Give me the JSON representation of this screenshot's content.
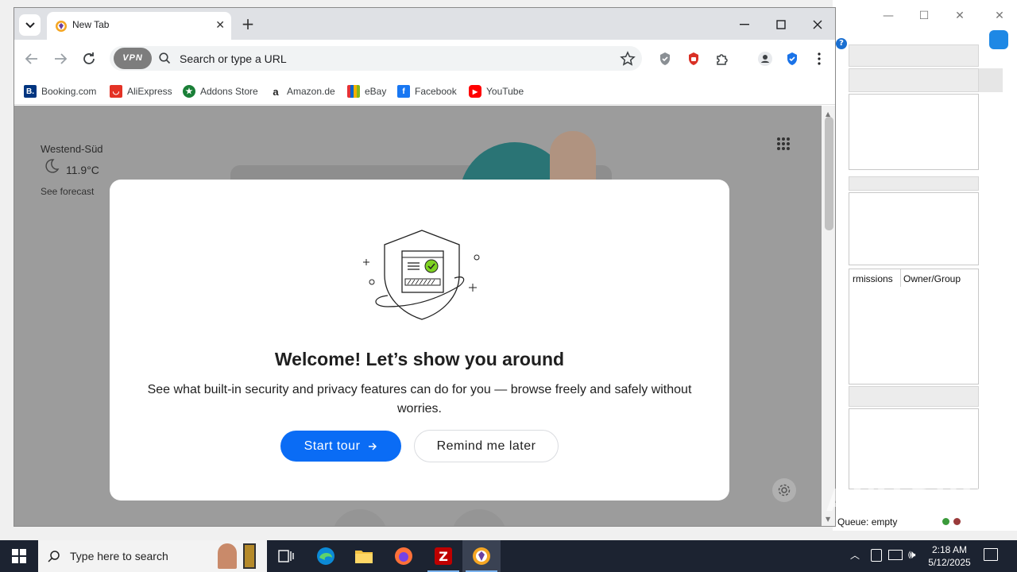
{
  "browser": {
    "tab_title": "New Tab",
    "omnibox_placeholder": "Search or type a URL",
    "vpn_label": "VPN"
  },
  "bookmarks": [
    {
      "label": "Booking.com",
      "icon": "booking-icon",
      "color": "#003580"
    },
    {
      "label": "AliExpress",
      "icon": "aliexpress-icon",
      "color": "#e43225"
    },
    {
      "label": "Addons Store",
      "icon": "addons-store-icon",
      "color": "#1a7f37"
    },
    {
      "label": "Amazon.de",
      "icon": "amazon-icon",
      "color": "#222222"
    },
    {
      "label": "eBay",
      "icon": "ebay-icon",
      "color": "#333333"
    },
    {
      "label": "Facebook",
      "icon": "facebook-icon",
      "color": "#1877f2"
    },
    {
      "label": "YouTube",
      "icon": "youtube-icon",
      "color": "#ff0000"
    }
  ],
  "weather": {
    "city": "Westend-Süd",
    "temperature": "11.9°C",
    "forecast_link": "See forecast"
  },
  "modal": {
    "title": "Welcome! Let’s show you around",
    "description": "See what built-in security and privacy features can do for you — browse freely and safely without worries.",
    "primary_button": "Start tour",
    "secondary_button": "Remind me later",
    "accent_color": "#0a6cf5"
  },
  "background_window": {
    "column_permissions": "rmissions",
    "column_owner": "Owner/Group",
    "queue_status": "Queue: empty"
  },
  "taskbar": {
    "search_placeholder": "Type here to search",
    "time": "2:18 AM",
    "date": "5/12/2025"
  },
  "watermark": "ANY.RUN"
}
